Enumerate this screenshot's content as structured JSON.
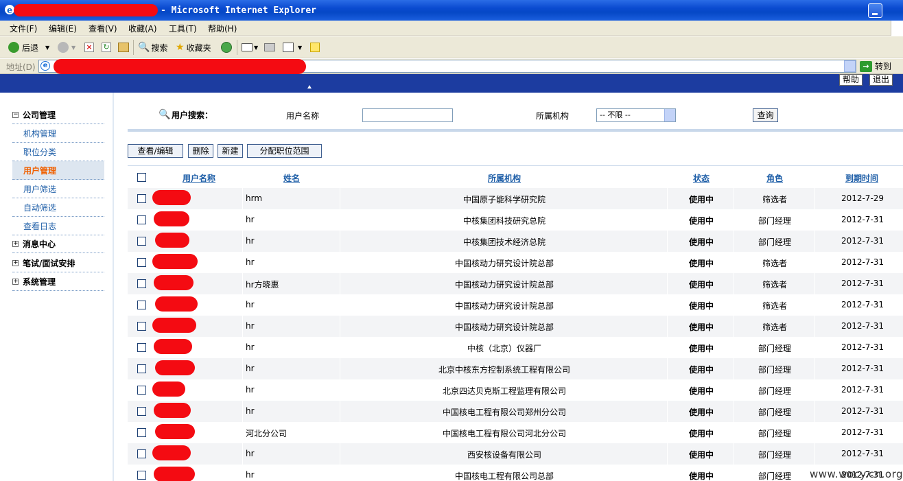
{
  "window": {
    "title": "- Microsoft Internet Explorer"
  },
  "menu": [
    "文件(F)",
    "编辑(E)",
    "查看(V)",
    "收藏(A)",
    "工具(T)",
    "帮助(H)"
  ],
  "toolbar": {
    "back_label": "后退",
    "search_label": "搜索",
    "favorites_label": "收藏夹"
  },
  "address": {
    "label": "地址(D)",
    "go_label": "转到"
  },
  "site_header": {
    "help_label": "帮助",
    "logout_label": "退出"
  },
  "sidebar": {
    "groups": [
      {
        "label": "公司管理",
        "expanded": true
      },
      {
        "label": "消息中心",
        "expanded": false
      },
      {
        "label": "笔试/面试安排",
        "expanded": false
      },
      {
        "label": "系统管理",
        "expanded": false
      }
    ],
    "items": [
      "机构管理",
      "职位分类",
      "用户管理",
      "用户筛选",
      "自动筛选",
      "查看日志"
    ],
    "active_item": "用户管理"
  },
  "search": {
    "title": "用户搜索：",
    "name_label": "用户名称",
    "name_value": "",
    "org_label": "所属机构",
    "org_selected": "-- 不限 --",
    "query_label": "查询"
  },
  "actions": {
    "view_edit": "查看/编辑",
    "delete": "删除",
    "create": "新建",
    "assign_scope": "分配职位范围"
  },
  "table": {
    "headers": {
      "username": "用户名称",
      "name": "姓名",
      "org": "所属机构",
      "status": "状态",
      "role": "角色",
      "expiry": "到期时间"
    },
    "rows": [
      {
        "name": "hrm",
        "org": "中国原子能科学研究院",
        "status": "使用中",
        "role": "筛选者",
        "expiry": "2012-7-29"
      },
      {
        "name": "hr",
        "org": "中核集团科技研究总院",
        "status": "使用中",
        "role": "部门经理",
        "expiry": "2012-7-31"
      },
      {
        "name": "hr",
        "org": "中核集团技术经济总院",
        "status": "使用中",
        "role": "部门经理",
        "expiry": "2012-7-31"
      },
      {
        "name": "hr",
        "org": "中国核动力研究设计院总部",
        "status": "使用中",
        "role": "筛选者",
        "expiry": "2012-7-31"
      },
      {
        "name": "hr方晓惠",
        "org": "中国核动力研究设计院总部",
        "status": "使用中",
        "role": "筛选者",
        "expiry": "2012-7-31"
      },
      {
        "name": "hr",
        "org": "中国核动力研究设计院总部",
        "status": "使用中",
        "role": "筛选者",
        "expiry": "2012-7-31"
      },
      {
        "name": "hr",
        "org": "中国核动力研究设计院总部",
        "status": "使用中",
        "role": "筛选者",
        "expiry": "2012-7-31"
      },
      {
        "name": "hr",
        "org": "中核（北京）仪器厂",
        "status": "使用中",
        "role": "部门经理",
        "expiry": "2012-7-31"
      },
      {
        "name": "hr",
        "org": "北京中核东方控制系统工程有限公司",
        "status": "使用中",
        "role": "部门经理",
        "expiry": "2012-7-31"
      },
      {
        "name": "hr",
        "org": "北京四达贝克斯工程监理有限公司",
        "status": "使用中",
        "role": "部门经理",
        "expiry": "2012-7-31"
      },
      {
        "name": "hr",
        "org": "中国核电工程有限公司郑州分公司",
        "status": "使用中",
        "role": "部门经理",
        "expiry": "2012-7-31"
      },
      {
        "name": "河北分公司",
        "org": "中国核电工程有限公司河北分公司",
        "status": "使用中",
        "role": "部门经理",
        "expiry": "2012-7-31"
      },
      {
        "name": "hr",
        "org": "西安核设备有限公司",
        "status": "使用中",
        "role": "部门经理",
        "expiry": "2012-7-31"
      },
      {
        "name": "hr",
        "org": "中国核电工程有限公司总部",
        "status": "使用中",
        "role": "部门经理",
        "expiry": "2012-7-31"
      }
    ]
  },
  "watermark": "www.wocy.cn.org",
  "colors": {
    "titlebar": "#0548c6",
    "redaction": "#f40b12",
    "link": "#1f5fa8",
    "active_item": "#f06000"
  }
}
